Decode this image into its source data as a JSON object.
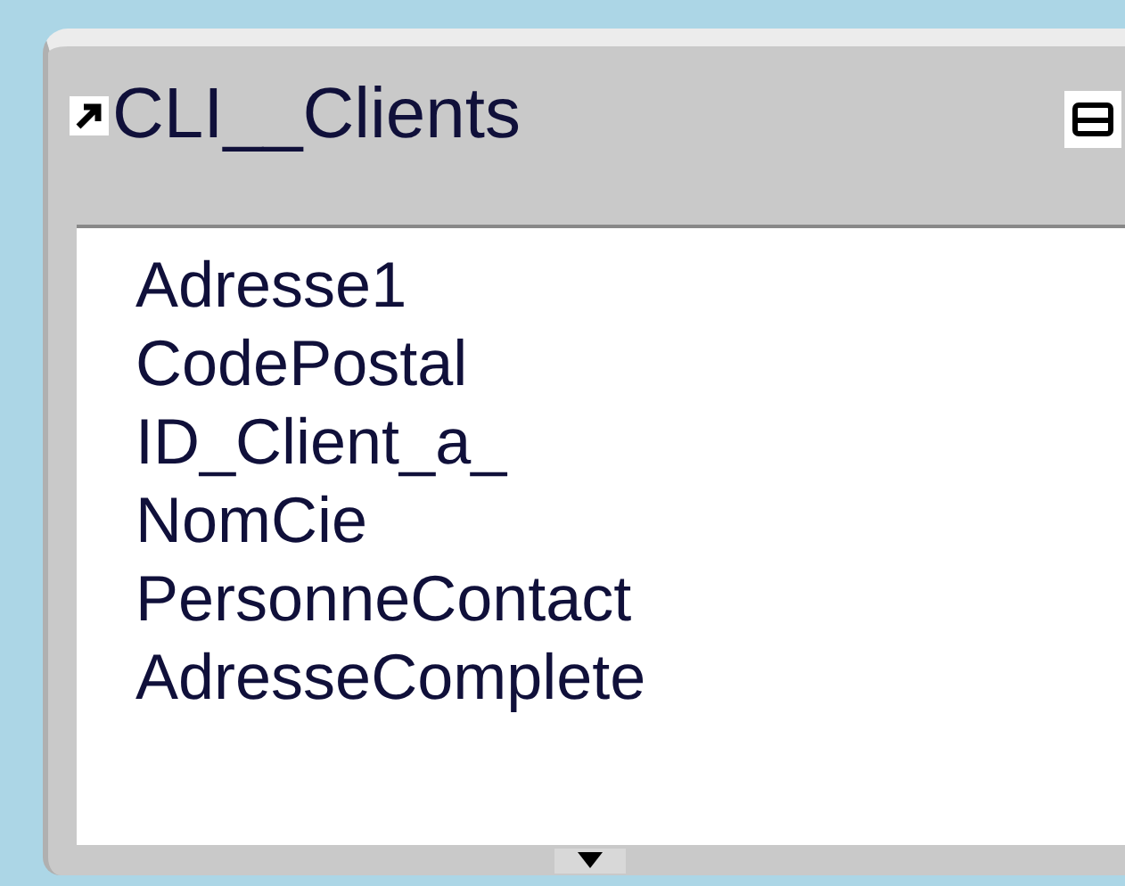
{
  "table": {
    "title": "CLI__Clients",
    "fields": [
      "Adresse1",
      "CodePostal",
      "ID_Client_a_",
      "NomCie",
      "PersonneContact",
      "AdresseComplete"
    ]
  }
}
